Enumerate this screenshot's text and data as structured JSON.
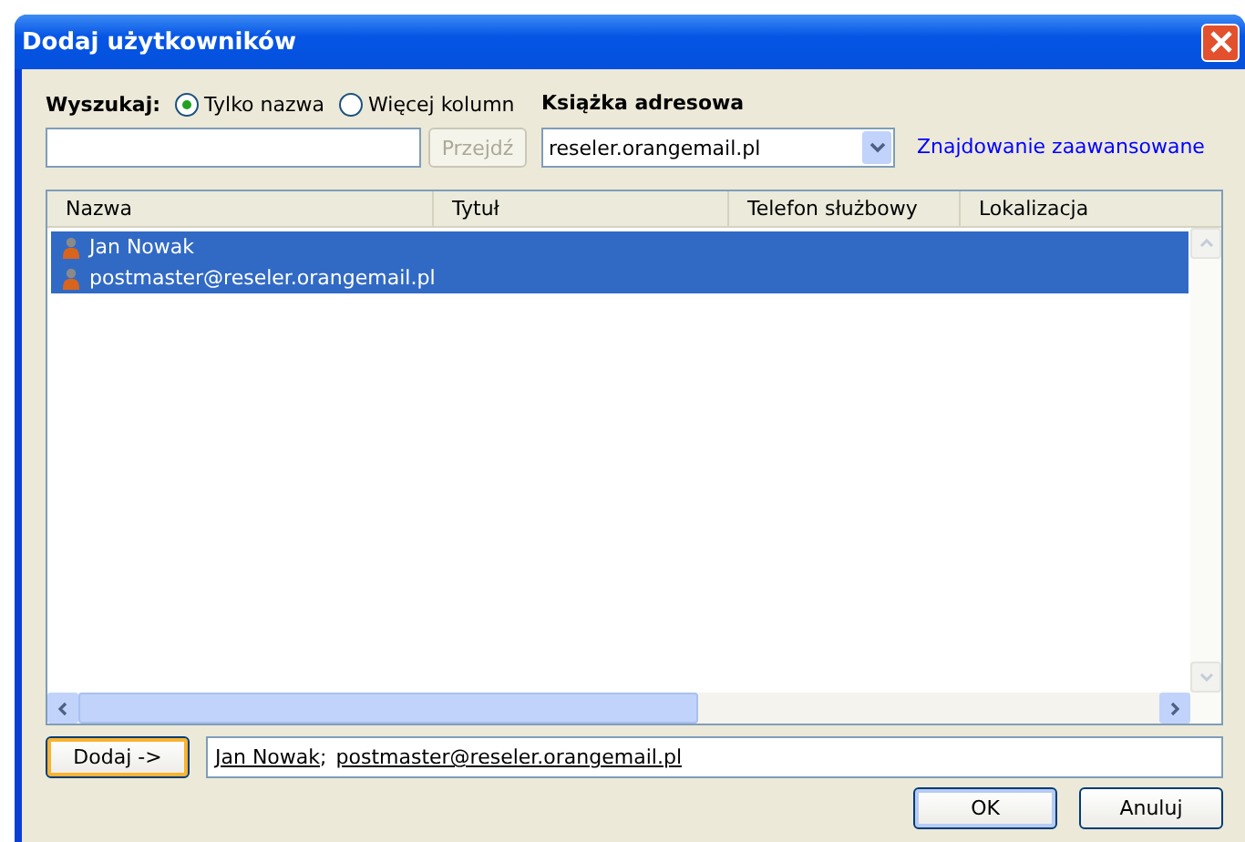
{
  "window": {
    "title": "Dodaj użytkowników"
  },
  "search": {
    "label": "Wyszukaj:",
    "options": [
      {
        "label": "Tylko nazwa",
        "selected": true
      },
      {
        "label": "Więcej kolumn",
        "selected": false
      }
    ],
    "go_button": {
      "label": "Przejdź",
      "disabled": true
    }
  },
  "address_book": {
    "label": "Książka adresowa",
    "value": "reseler.orangemail.pl"
  },
  "advanced_link": "Znajdowanie zaawansowane",
  "table": {
    "columns": [
      "Nazwa",
      "Tytuł",
      "Telefon służbowy",
      "Lokalizacja"
    ],
    "rows": [
      {
        "name": "Jan Nowak",
        "selected": true
      },
      {
        "name": "postmaster@reseler.orangemail.pl",
        "selected": true
      }
    ]
  },
  "add_button": "Dodaj ->",
  "recipients": {
    "items": [
      "Jan Nowak",
      "postmaster@reseler.orangemail.pl"
    ],
    "separator": ";"
  },
  "buttons": [
    "OK",
    "Anuluj"
  ]
}
